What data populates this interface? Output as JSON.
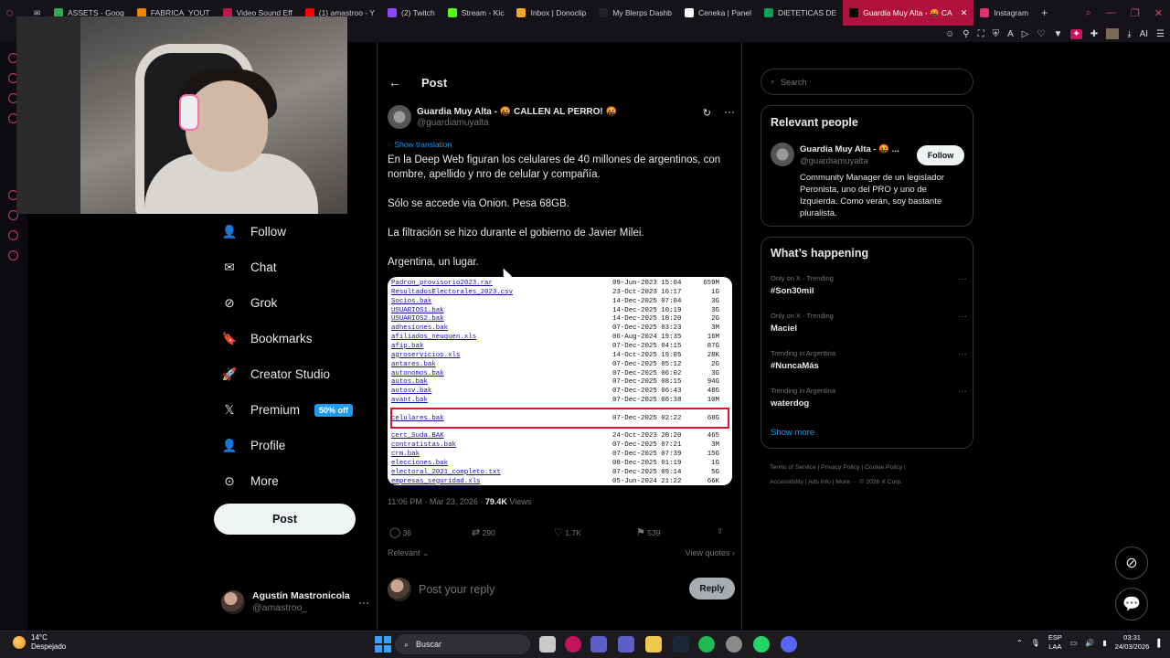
{
  "browser": {
    "tabs": [
      {
        "label": "ASSETS - Goog",
        "color": "#34a853"
      },
      {
        "label": "FABRICA_YOUT",
        "color": "#ea8600"
      },
      {
        "label": "Video Sound Eff",
        "color": "#c0184c"
      },
      {
        "label": "(1) amastroo - Y",
        "color": "#ff0000"
      },
      {
        "label": "(2) Twitch",
        "color": "#9146ff"
      },
      {
        "label": "Stream - Kic",
        "color": "#53fc18"
      },
      {
        "label": "Inbox | Donoclip",
        "color": "#f5a623"
      },
      {
        "label": "My Blerps Dashb",
        "color": "#222222"
      },
      {
        "label": "Ceneka | Panel",
        "color": "#ffffff"
      },
      {
        "label": "DIETETICAS DE",
        "color": "#0f9d58"
      },
      {
        "label": "Guardia Muy Alta - 🤬 CA",
        "color": "#000000"
      },
      {
        "label": "Instagram",
        "color": "#e1306c"
      }
    ],
    "active_tab_index": 10,
    "new_tab": "+"
  },
  "nav": {
    "items": [
      {
        "label": "Follow",
        "icon": "person-plus-icon"
      },
      {
        "label": "Chat",
        "icon": "mail-icon"
      },
      {
        "label": "Grok",
        "icon": "grok-icon"
      },
      {
        "label": "Bookmarks",
        "icon": "bookmark-icon"
      },
      {
        "label": "Creator Studio",
        "icon": "rocket-icon"
      },
      {
        "label": "Premium",
        "icon": "x-logo-icon",
        "badge": "50% off"
      },
      {
        "label": "Profile",
        "icon": "person-icon"
      },
      {
        "label": "More",
        "icon": "more-circle-icon"
      }
    ],
    "post_button": "Post",
    "account": {
      "name": "Agustín Mastronicola",
      "handle": "@amastroo_"
    }
  },
  "post": {
    "header_title": "Post",
    "author_name": "Guardia Muy Alta - 🤬 CALLEN AL PERRO! 🤬",
    "author_handle": "@guardiamuyalta",
    "show_translation": "Show translation",
    "paragraphs": [
      "En la Deep Web figuran los celulares de 40 millones de argentinos, con nombre, apellido y nro de celular y compañía.",
      "Sólo se accede via Onion. Pesa 68GB.",
      "La filtración se hizo durante el gobierno de Javier Milei.",
      "Argentina, un lugar."
    ],
    "file_listing": [
      {
        "name": "Padron_provisorio2023.rar",
        "date": "09-Jun-2023 15:04",
        "size": "659M"
      },
      {
        "name": "ResultadosElectorales_2023.csv",
        "date": "23-Oct-2023 16:17",
        "size": "1G"
      },
      {
        "name": "Socios.bak",
        "date": "14-Dec-2025 07:04",
        "size": "3G"
      },
      {
        "name": "USUARIOS1.bak",
        "date": "14-Dec-2025 10:19",
        "size": "3G"
      },
      {
        "name": "USUARIOS2.bak",
        "date": "14-Dec-2025 10:20",
        "size": "2G"
      },
      {
        "name": "adhesiones.bak",
        "date": "07-Dec-2025 03:23",
        "size": "3M"
      },
      {
        "name": "afiliados_neuquen.xls",
        "date": "06-Aug-2024 19:35",
        "size": "16M"
      },
      {
        "name": "afip.bak",
        "date": "07-Dec-2025 04:15",
        "size": "87G"
      },
      {
        "name": "agroservicios.xls",
        "date": "14-Oct-2025 19:05",
        "size": "28K"
      },
      {
        "name": "antares.bak",
        "date": "07-Dec-2025 05:12",
        "size": "2G"
      },
      {
        "name": "autonomos.bak",
        "date": "07-Dec-2025 06:02",
        "size": "3G"
      },
      {
        "name": "autos.bak",
        "date": "07-Dec-2025 08:15",
        "size": "94G"
      },
      {
        "name": "autosv.bak",
        "date": "07-Dec-2025 06:43",
        "size": "48G"
      },
      {
        "name": "avant.bak",
        "date": "07-Dec-2025 06:38",
        "size": "10M"
      },
      {
        "name": "",
        "date": "",
        "size": ""
      },
      {
        "name": "celulares.bak",
        "date": "07-Dec-2025 02:22",
        "size": "68G"
      },
      {
        "name": "",
        "date": "",
        "size": ""
      },
      {
        "name": "cert_Suda.BAK",
        "date": "24-Oct-2023 20:20",
        "size": "465"
      },
      {
        "name": "contratistas.bak",
        "date": "07-Dec-2025 07:21",
        "size": "3M"
      },
      {
        "name": "crm.bak",
        "date": "07-Dec-2025 07:39",
        "size": "15G"
      },
      {
        "name": "elecciones.bak",
        "date": "08-Dec-2025 01:19",
        "size": "1G"
      },
      {
        "name": "electoral_2021_completo.txt",
        "date": "07-Dec-2025 09:14",
        "size": "5G"
      },
      {
        "name": "empresas_seguridad.xls",
        "date": "05-Jun-2024 21:22",
        "size": "66K"
      }
    ],
    "timestamp": "11:06 PM · Mar 23, 2026 · ",
    "views_count": "79.4K",
    "views_label": " Views",
    "replies": "36",
    "reposts": "290",
    "likes": "1.7K",
    "bookmarks": "539",
    "relevant_label": "Relevant",
    "view_quotes": "View quotes",
    "reply_placeholder": "Post your reply",
    "reply_button": "Reply"
  },
  "sidebar": {
    "search_placeholder": "Search",
    "relevant_people_title": "Relevant people",
    "person": {
      "name": "Guardia Muy Alta - 🤬 ...",
      "handle": "@guardiamuyalta",
      "follow_label": "Follow",
      "bio": "Community Manager de un legislador Peronista, uno del PRO y uno de Izquierda. Como verán, soy bastante pluralista."
    },
    "happening_title": "What’s happening",
    "trends": [
      {
        "context": "Only on X · Trending",
        "topic": "#Son30mil"
      },
      {
        "context": "Only on X · Trending",
        "topic": "Maciel"
      },
      {
        "context": "Trending in Argentina",
        "topic": "#NuncaMás"
      },
      {
        "context": "Trending in Argentina",
        "topic": "waterdog"
      }
    ],
    "show_more": "Show more",
    "footer_line1": "Terms of Service  |  Privacy Policy  |  Cookie Policy  |",
    "footer_line2": "Accessibility  |  Ads info  |  More ···  © 2026 X Corp."
  },
  "taskbar": {
    "temperature": "14°C",
    "weather": "Despejado",
    "search": "Buscar",
    "lang_top": "ESP",
    "lang_bottom": "LAA",
    "time": "03:31",
    "date": "24/03/2026"
  }
}
